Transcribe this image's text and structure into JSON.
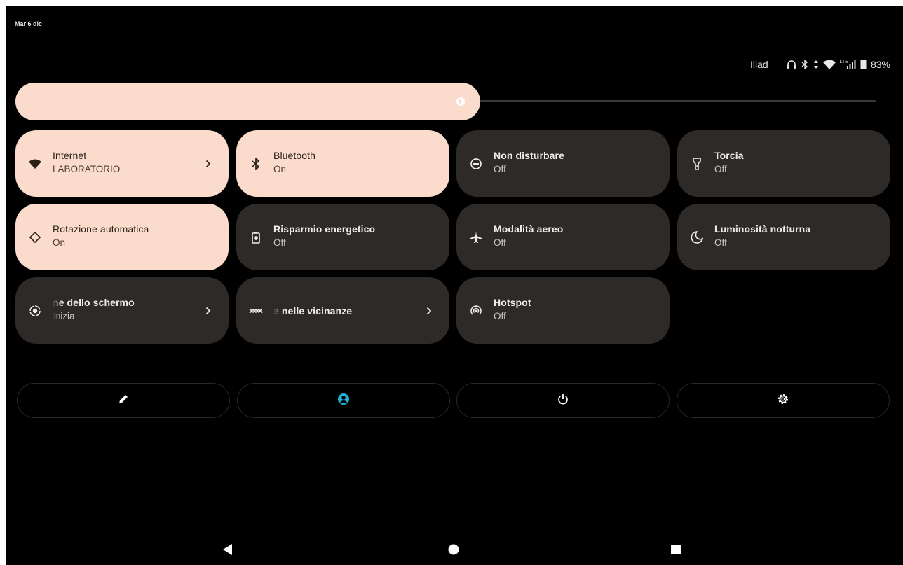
{
  "status_bar": {
    "date": "Mar 6 dic",
    "carrier": "Iliad",
    "network_type": "LTE",
    "battery": "83%",
    "icons": [
      "headphones-icon",
      "bluetooth-icon",
      "data-arrows-icon",
      "wifi-icon",
      "signal-icon",
      "battery-icon"
    ]
  },
  "brightness": {
    "level": 0.55,
    "icon": "brightness-icon"
  },
  "tiles": [
    {
      "label": "Internet",
      "sub": "LABORATORIO",
      "state": "on",
      "icon": "wifi-icon",
      "chevron": true
    },
    {
      "label": "Bluetooth",
      "sub": "On",
      "state": "on",
      "icon": "bluetooth-icon",
      "chevron": false
    },
    {
      "label": "Non disturbare",
      "sub": "Off",
      "state": "off",
      "icon": "do-not-disturb-icon",
      "chevron": false
    },
    {
      "label": "Torcia",
      "sub": "Off",
      "state": "off",
      "icon": "flashlight-icon",
      "chevron": false
    },
    {
      "label": "Rotazione automatica",
      "sub": "On",
      "state": "on",
      "icon": "auto-rotate-icon",
      "chevron": false
    },
    {
      "label": "Risparmio energetico",
      "sub": "Off",
      "state": "off",
      "icon": "battery-saver-icon",
      "chevron": false
    },
    {
      "label": "Modalità aereo",
      "sub": "Off",
      "state": "off",
      "icon": "airplane-icon",
      "chevron": false
    },
    {
      "label": "Luminosità notturna",
      "sub": "Off",
      "state": "off",
      "icon": "night-light-icon",
      "chevron": false
    },
    {
      "label": "ne dello schermo",
      "sub": "Inizia",
      "state": "off",
      "icon": "screen-record-icon",
      "chevron": true
    },
    {
      "label": "e nelle vicinanze",
      "sub": "",
      "state": "off",
      "icon": "nearby-share-icon",
      "chevron": true
    },
    {
      "label": "Hotspot",
      "sub": "Off",
      "state": "off",
      "icon": "hotspot-icon",
      "chevron": false
    }
  ],
  "actions": [
    {
      "icon": "edit-icon"
    },
    {
      "icon": "user-icon"
    },
    {
      "icon": "power-icon"
    },
    {
      "icon": "settings-icon"
    }
  ],
  "colors": {
    "tile_on": "#fbdccc",
    "tile_off": "#2e2a27",
    "accent": "#1fb4d8",
    "background": "#000000"
  },
  "nav": [
    "back-icon",
    "home-icon",
    "recents-icon"
  ]
}
